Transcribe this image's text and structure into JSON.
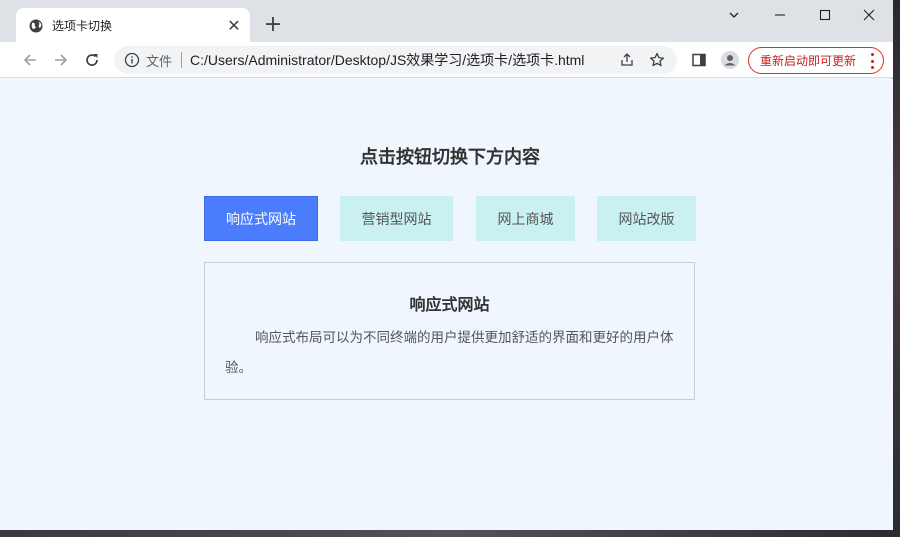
{
  "browser": {
    "tab_title": "选项卡切换",
    "tab_close": "✕",
    "new_tab": "+",
    "scheme_label": "文件",
    "url": "C:/Users/Administrator/Desktop/JS效果学习/选项卡/选项卡.html",
    "update_label": "重新启动即可更新",
    "icons": {
      "favicon": "globe-icon",
      "back": "arrow-left-icon",
      "forward": "arrow-right-icon",
      "reload": "reload-icon",
      "info": "info-icon",
      "share": "share-icon",
      "bookmark": "star-icon",
      "sidepanel": "side-panel-icon",
      "profile": "profile-icon",
      "menu": "kebab-menu-icon"
    },
    "colors": {
      "update_accent": "#d93025"
    }
  },
  "page": {
    "heading": "点击按钮切换下方内容",
    "tabs": [
      {
        "label": "响应式网站",
        "active": true
      },
      {
        "label": "营销型网站",
        "active": false
      },
      {
        "label": "网上商城",
        "active": false
      },
      {
        "label": "网站改版",
        "active": false
      }
    ],
    "content": {
      "title": "响应式网站",
      "text": "响应式布局可以为不同终端的用户提供更加舒适的界面和更好的用户体验。"
    },
    "colors": {
      "background": "#f0f6fd",
      "active_tab": "#4a7cfb",
      "inactive_tab": "#c9f1f1"
    }
  }
}
